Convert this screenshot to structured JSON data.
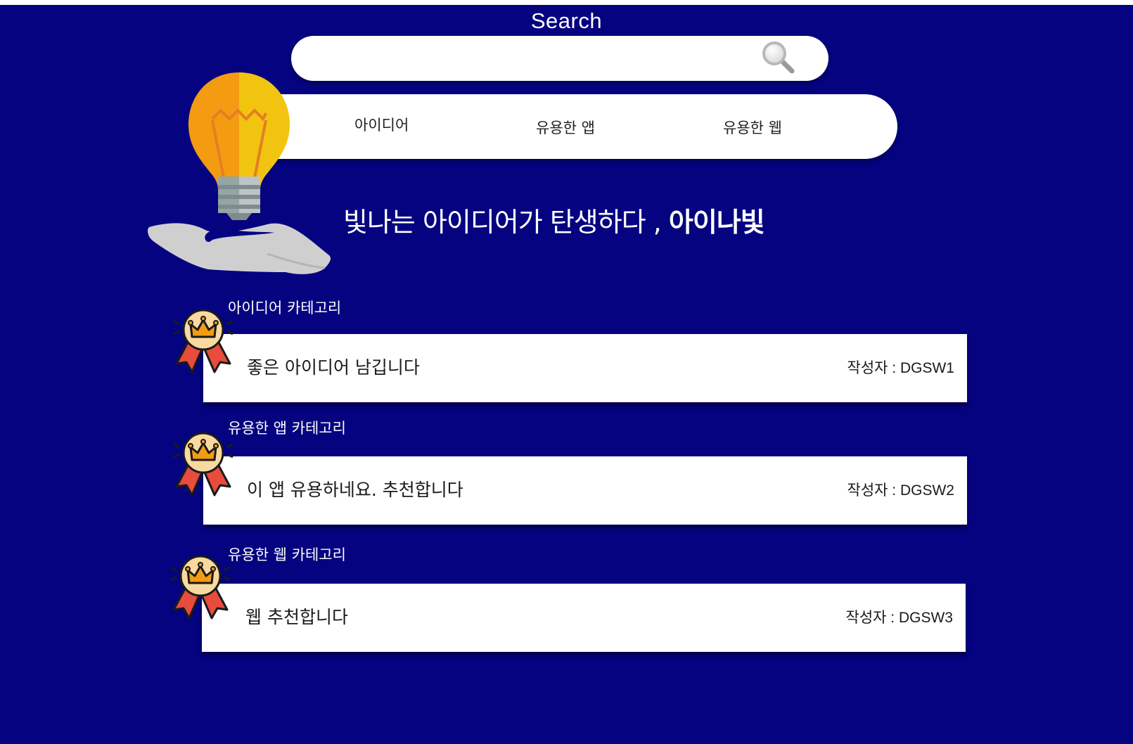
{
  "colors": {
    "background": "#050380",
    "card": "#ffffff",
    "bulb_left": "#f39c12",
    "bulb_right": "#f1c40f",
    "medal_ribbon": "#e74c3c",
    "medal_face": "#f8d9a0"
  },
  "header": {
    "search_label": "Search",
    "search_placeholder": "",
    "search_icon": "magnifier-icon"
  },
  "nav": {
    "items": [
      {
        "label": "아이디어"
      },
      {
        "label": "유용한 앱"
      },
      {
        "label": "유용한 웹"
      }
    ]
  },
  "hero": {
    "tagline": "빛나는 아이디어가 탄생하다 , ",
    "brand": "아이나빛",
    "illustration": "lightbulb-in-hand-icon"
  },
  "categories": [
    {
      "label": "아이디어 카테고리",
      "post_title": "좋은 아이디어 남깁니다",
      "author": "작성자 : DGSW1",
      "badge_icon": "crown-medal-icon"
    },
    {
      "label": "유용한 앱  카테고리",
      "post_title": "이 앱 유용하네요. 추천합니다",
      "author": "작성자 : DGSW2",
      "badge_icon": "crown-medal-icon"
    },
    {
      "label": "유용한 웹  카테고리",
      "post_title": "웹 추천합니다",
      "author": "작성자 : DGSW3",
      "badge_icon": "crown-medal-icon"
    }
  ]
}
